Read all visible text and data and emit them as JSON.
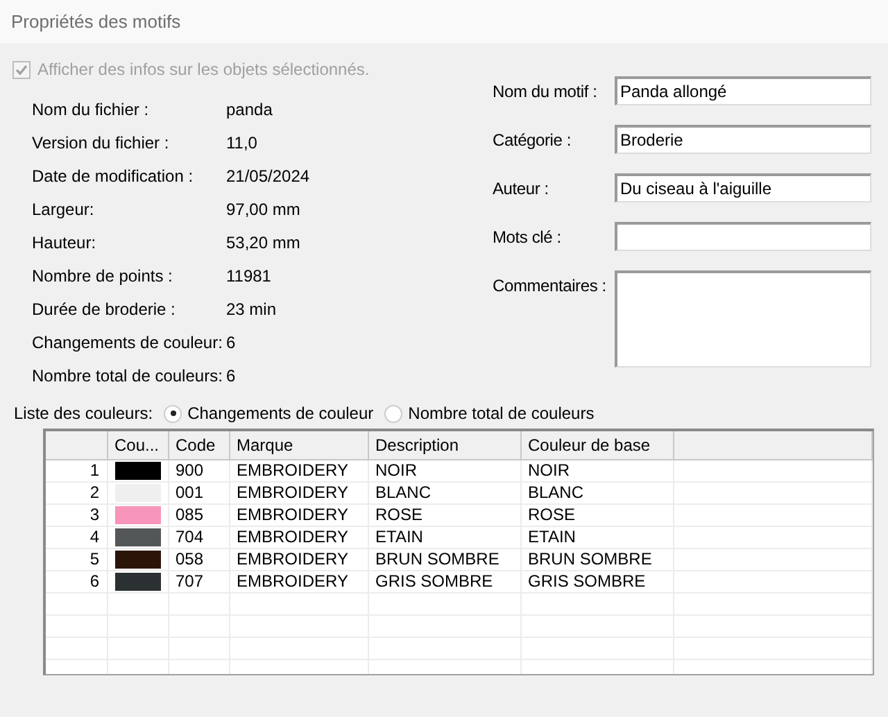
{
  "panel": {
    "title": "Propriétés des motifs"
  },
  "show_info": {
    "label": "Afficher des infos sur les objets sélectionnés.",
    "checked": true,
    "disabled": true
  },
  "info": [
    {
      "label": "Nom du fichier :",
      "value": "panda"
    },
    {
      "label": "Version du fichier :",
      "value": "11,0"
    },
    {
      "label": "Date de modification :",
      "value": "21/05/2024"
    },
    {
      "label": "Largeur:",
      "value": "97,00 mm"
    },
    {
      "label": "Hauteur:",
      "value": "53,20 mm"
    },
    {
      "label": "Nombre de points :",
      "value": "11981"
    },
    {
      "label": "Durée de broderie :",
      "value": "23 min"
    },
    {
      "label": "Changements de couleur:",
      "value": "6"
    },
    {
      "label": "Nombre total de couleurs:",
      "value": "6"
    }
  ],
  "fields": [
    {
      "label": "Nom du motif :",
      "value": "Panda allongé",
      "kind": "line"
    },
    {
      "label": "Catégorie :",
      "value": "Broderie",
      "kind": "line"
    },
    {
      "label": "Auteur :",
      "value": "Du ciseau à l'aiguille",
      "kind": "line"
    },
    {
      "label": "Mots clé :",
      "kind": "line"
    },
    {
      "label": "Commentaires :",
      "kind": "multiline"
    }
  ],
  "color_list": {
    "label": "Liste des couleurs:",
    "options": [
      {
        "label": "Changements de couleur",
        "selected": true
      },
      {
        "label": "Nombre total de couleurs",
        "selected": false
      }
    ]
  },
  "table": {
    "columns": [
      "Cou...",
      "Code",
      "Marque",
      "Description",
      "Couleur de base"
    ],
    "rows": [
      {
        "index": "1",
        "color": "#000000",
        "code": "900",
        "brand": "EMBROIDERY",
        "description": "NOIR",
        "base": "NOIR"
      },
      {
        "index": "2",
        "color": "#efefef",
        "code": "001",
        "brand": "EMBROIDERY",
        "description": "BLANC",
        "base": "BLANC"
      },
      {
        "index": "3",
        "color": "#f895bb",
        "code": "085",
        "brand": "EMBROIDERY",
        "description": "ROSE",
        "base": "ROSE"
      },
      {
        "index": "4",
        "color": "#545758",
        "code": "704",
        "brand": "EMBROIDERY",
        "description": "ETAIN",
        "base": "ETAIN"
      },
      {
        "index": "5",
        "color": "#2b1509",
        "code": "058",
        "brand": "EMBROIDERY",
        "description": "BRUN SOMBRE",
        "base": "BRUN SOMBRE"
      },
      {
        "index": "6",
        "color": "#2b3032",
        "code": "707",
        "brand": "EMBROIDERY",
        "description": "GRIS SOMBRE",
        "base": "GRIS SOMBRE"
      }
    ]
  }
}
